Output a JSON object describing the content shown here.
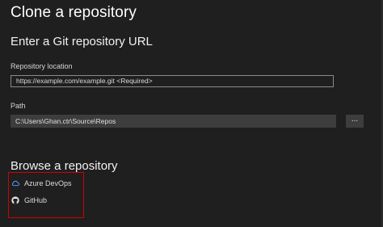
{
  "dialog": {
    "title": "Clone a repository"
  },
  "clone_section": {
    "heading": "Enter a Git repository URL",
    "repo_location_label": "Repository location",
    "repo_location_value": "https://example.com/example.git <Required>",
    "path_label": "Path",
    "path_value": "C:\\Users\\Ghan.ctr\\Source\\Repos",
    "browse_button_label": "..."
  },
  "browse_section": {
    "heading": "Browse a repository",
    "providers": [
      {
        "label": "Azure DevOps",
        "icon": "cloud-icon"
      },
      {
        "label": "GitHub",
        "icon": "github-icon"
      }
    ],
    "highlight_color": "#d10000"
  }
}
